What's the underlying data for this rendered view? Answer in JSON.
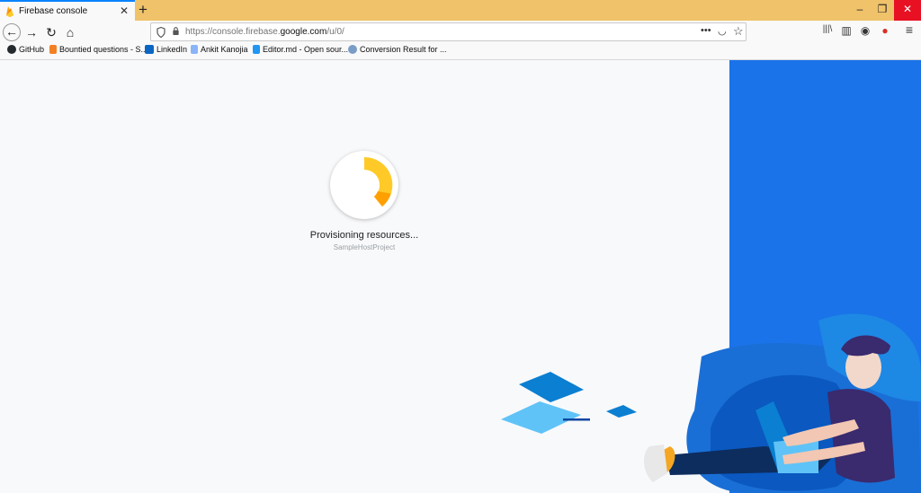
{
  "browser": {
    "tab": {
      "title": "Firebase console",
      "close_glyph": "✕"
    },
    "new_tab_glyph": "+",
    "window_controls": {
      "minimize": "–",
      "maximize": "❐",
      "close": "✕"
    },
    "nav": {
      "back": "←",
      "forward": "→",
      "reload": "↻",
      "home": "⌂"
    },
    "url": {
      "prefix": "https://console.firebase.",
      "domain": "google.com",
      "suffix": "/u/0/"
    },
    "url_actions": {
      "more": "•••",
      "pocket": "◡",
      "star": "☆"
    },
    "toolbar": {
      "library": "|||\\",
      "sidebar": "▥",
      "account": "◉",
      "menu": "≡"
    },
    "bookmarks": [
      {
        "label": "GitHub",
        "icon": "github-icon",
        "color": "#24292e"
      },
      {
        "label": "Bountied questions - S...",
        "icon": "stackoverflow-icon",
        "color": "#f48024"
      },
      {
        "label": "LinkedIn",
        "icon": "linkedin-icon",
        "color": "#0a66c2"
      },
      {
        "label": "Ankit Kanojia",
        "icon": "person-icon",
        "color": "#8ab4f8"
      },
      {
        "label": "Editor.md - Open sour...",
        "icon": "editor-icon",
        "color": "#2196f3"
      },
      {
        "label": "Conversion Result for ...",
        "icon": "conversion-icon",
        "color": "#7a9cc6"
      }
    ]
  },
  "page": {
    "status": "Provisioning resources...",
    "project": "SampleHostProject",
    "colors": {
      "accent_blue": "#1a73e8",
      "spinner_yellow": "#ffca28",
      "spinner_orange": "#ffa000"
    }
  }
}
